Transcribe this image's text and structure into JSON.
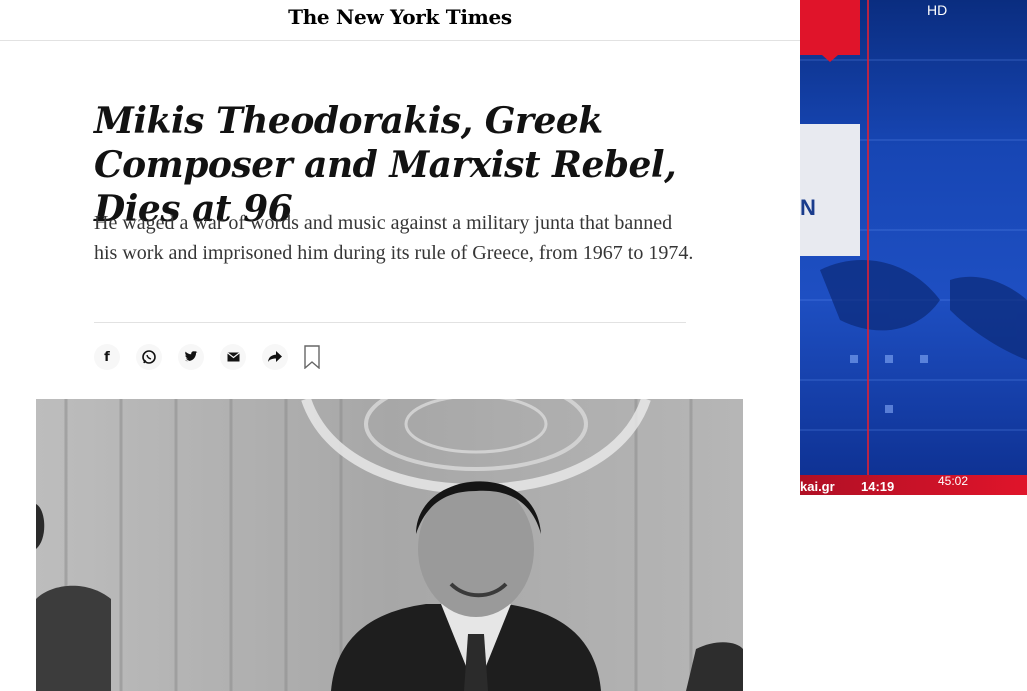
{
  "masthead": {
    "title": "The New York Times"
  },
  "article": {
    "headline": "Mikis Theodorakis, Greek Composer and Marxist Rebel, Dies at 96",
    "summary": "He waged a war of words and music against a military junta that banned his work and imprisoned him during its rule of Greece, from 1967 to 1974."
  },
  "share": {
    "buttons": [
      {
        "icon": "facebook-icon",
        "glyph": "f"
      },
      {
        "icon": "whatsapp-icon",
        "glyph": "◎"
      },
      {
        "icon": "twitter-icon",
        "glyph": "✓"
      },
      {
        "icon": "email-icon",
        "glyph": "✉"
      },
      {
        "icon": "share-arrow-icon",
        "glyph": "➦"
      }
    ],
    "bookmark_icon": "bookmark-icon"
  },
  "video": {
    "quality_label": "HD",
    "card_letter": "N",
    "ticker_site": "kai.gr",
    "ticker_time": "14:19",
    "duration": "45:02"
  },
  "colors": {
    "nyt_text": "#121212",
    "summary_text": "#363636",
    "video_blue": "#1e4fc2",
    "news_red": "#e0142a"
  }
}
